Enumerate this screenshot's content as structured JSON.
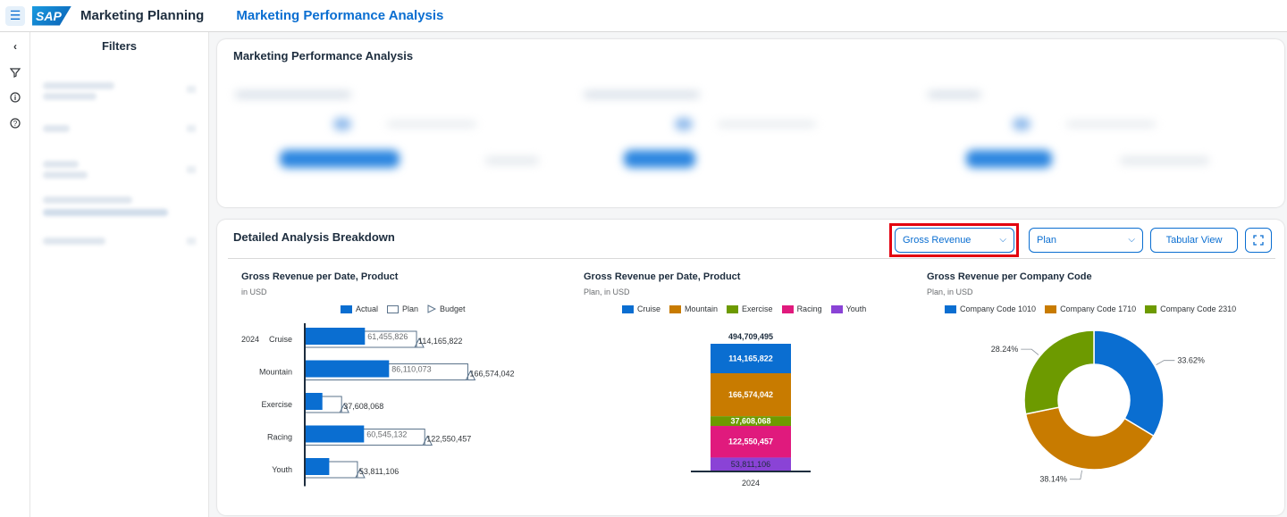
{
  "shell": {
    "menu_icon": "hamburger-icon",
    "logo_text": "SAP",
    "app_title": "Marketing Planning",
    "page_title": "Marketing Performance Analysis"
  },
  "rail": {
    "icons": [
      "collapse-chevron-icon",
      "filter-icon",
      "info-icon",
      "help-icon"
    ]
  },
  "filters": {
    "title": "Filters"
  },
  "performance_card": {
    "title": "Marketing Performance Analysis"
  },
  "breakdown": {
    "title": "Detailed Analysis Breakdown",
    "measure_select": "Gross Revenue",
    "version_select": "Plan",
    "tabular_view": "Tabular View",
    "fullscreen_icon": "fullscreen-icon",
    "highlight_color": "#e3000f"
  },
  "colors": {
    "accent": "#0a6ed1",
    "actual": "#0a6ed1",
    "cruise": "#0a6ed1",
    "mountain": "#c87b00",
    "exercise": "#6d9a00",
    "racing": "#e01a7d",
    "youth": "#8a43d6",
    "cc1010": "#0a6ed1",
    "cc1710": "#c87b00",
    "cc2310": "#6d9a00"
  },
  "chart_data": [
    {
      "type": "bar",
      "orientation": "horizontal",
      "title": "Gross Revenue per Date, Product",
      "subtitle": "in USD",
      "legend": [
        "Actual",
        "Plan",
        "Budget"
      ],
      "year_label": "2024",
      "categories": [
        "Cruise",
        "Mountain",
        "Exercise",
        "Racing",
        "Youth"
      ],
      "series": [
        {
          "name": "Actual",
          "values": [
            61455826,
            86110073,
            18000000,
            60545132,
            25000000
          ]
        },
        {
          "name": "Plan",
          "values": [
            114165822,
            166574042,
            37608068,
            122550457,
            53811106
          ]
        }
      ],
      "actual_labels": [
        "61,455,826",
        "86,110,073",
        "",
        "60,545,132",
        ""
      ],
      "plan_labels": [
        "114,165,822",
        "166,574,042",
        "37,608,068",
        "122,550,457",
        "53,811,106"
      ],
      "xlim": [
        0,
        210000000
      ]
    },
    {
      "type": "bar",
      "stacked": true,
      "title": "Gross Revenue per Date, Product",
      "subtitle": "Plan, in USD",
      "legend": [
        "Cruise",
        "Mountain",
        "Exercise",
        "Racing",
        "Youth"
      ],
      "categories": [
        "2024"
      ],
      "total_label": "494,709,495",
      "total": 494709495,
      "segments": [
        {
          "name": "Cruise",
          "value": 114165822,
          "label": "114,165,822"
        },
        {
          "name": "Mountain",
          "value": 166574042,
          "label": "166,574,042"
        },
        {
          "name": "Exercise",
          "value": 37608068,
          "label": "37,608,068"
        },
        {
          "name": "Racing",
          "value": 122550457,
          "label": "122,550,457"
        },
        {
          "name": "Youth",
          "value": 53811106,
          "label": "53,811,106"
        }
      ]
    },
    {
      "type": "pie",
      "donut": true,
      "title": "Gross Revenue per Company Code",
      "subtitle": "Plan, in USD",
      "legend": [
        "Company Code 1010",
        "Company Code 1710",
        "Company Code 2310"
      ],
      "slices": [
        {
          "name": "Company Code 1010",
          "value": 33.62,
          "label": "33.62%"
        },
        {
          "name": "Company Code 1710",
          "value": 38.14,
          "label": "38.14%"
        },
        {
          "name": "Company Code 2310",
          "value": 28.24,
          "label": "28.24%"
        }
      ]
    }
  ]
}
